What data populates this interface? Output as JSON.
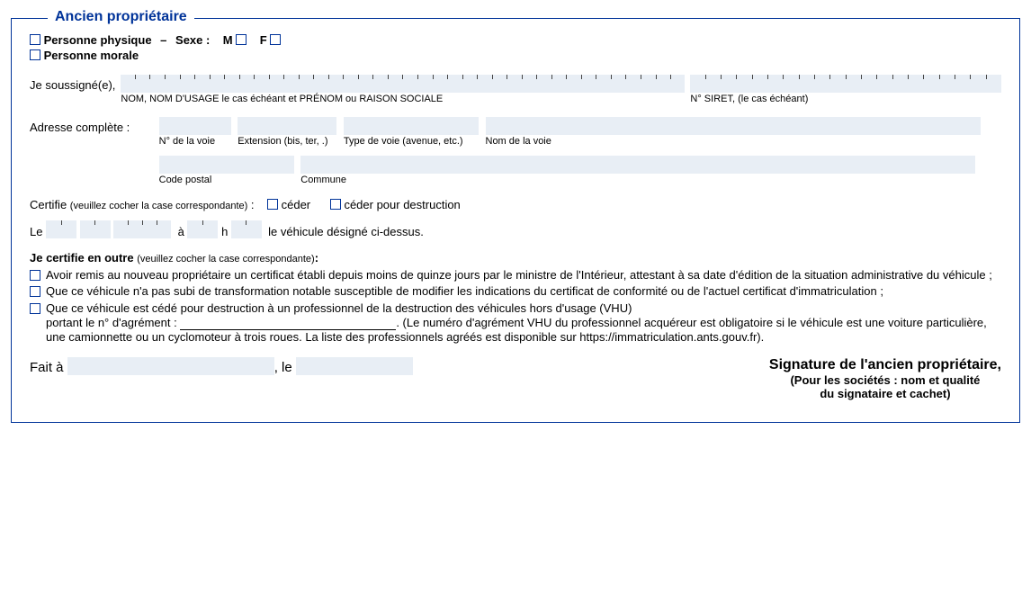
{
  "section_title": "Ancien propriétaire",
  "person": {
    "physical": "Personne physique",
    "dash": "–",
    "sexe_label": "Sexe :",
    "sexe_m": "M",
    "sexe_f": "F",
    "moral": "Personne morale"
  },
  "undersigned": {
    "label": "Je soussigné(e),",
    "name_hint": "NOM, NOM D'USAGE le cas échéant et PRÉNOM ou RAISON SOCIALE",
    "siret_hint": "N° SIRET, (le cas échéant)"
  },
  "address": {
    "label": "Adresse complète :",
    "num_voie": "N° de la voie",
    "extension": "Extension (bis, ter, .)",
    "type_voie": "Type de voie (avenue, etc.)",
    "nom_voie": "Nom de la voie",
    "code_postal": "Code postal",
    "commune": "Commune"
  },
  "certify": {
    "label_a": "Certifie ",
    "hint_a": "(veuillez cocher la case correspondante)",
    "colon": " :",
    "ceder": "céder",
    "ceder_destr": "céder pour destruction",
    "le": "Le",
    "a": "à",
    "h": "h",
    "tail": "le véhicule désigné ci-dessus."
  },
  "further": {
    "lead": "Je certifie en outre ",
    "hint": "(veuillez cocher la case correspondante)",
    "colon": ":",
    "item1": "Avoir remis au nouveau propriétaire un certificat établi depuis moins de quinze jours par le ministre de l'Intérieur, attestant à sa date d'édition de la situation administrative du véhicule ;",
    "item2": "Que ce véhicule n'a pas subi de transformation notable susceptible de modifier les indications du certificat de conformité ou de l'actuel certificat d'immatriculation ;",
    "item3a": "Que ce véhicule est cédé pour destruction à un professionnel de la destruction des véhicules hors d'usage (VHU)",
    "item3b_pre": "portant le n° d'agrément : ",
    "item3b_post": ". (Le numéro d'agrément VHU du professionnel acquéreur est obligatoire si le véhicule est une voiture particulière, une camionnette ou un cyclomoteur à trois roues. La liste des professionnels agréés est disponible sur https://immatriculation.ants.gouv.fr)."
  },
  "footer": {
    "fait_a": "Fait à",
    "le": ", le",
    "sig_title": "Signature de l'ancien propriétaire,",
    "sig_sub1": "(Pour les sociétés : nom et qualité",
    "sig_sub2": "du signataire et cachet)"
  }
}
